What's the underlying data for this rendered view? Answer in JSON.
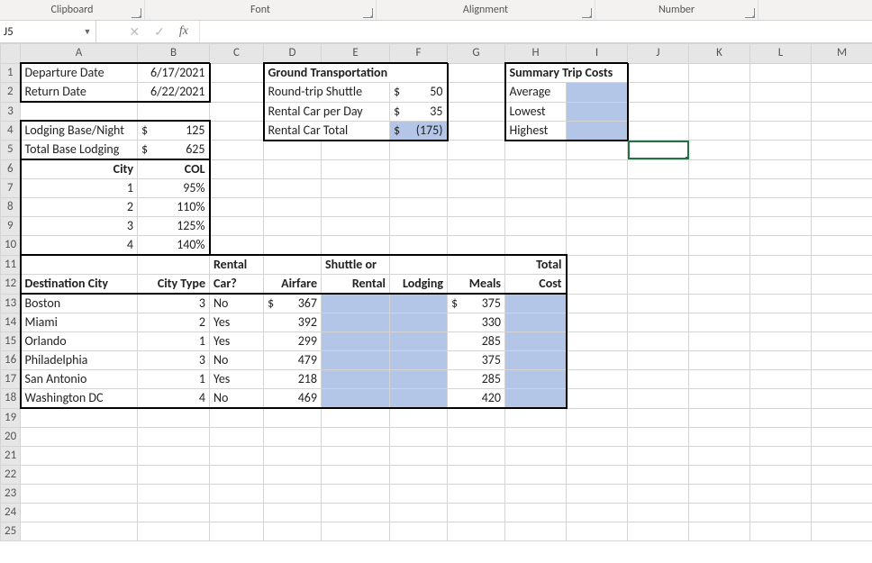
{
  "ribbon": {
    "groups": [
      "Clipboard",
      "Font",
      "Alignment",
      "Number"
    ]
  },
  "namebox": {
    "cell_ref": "J5"
  },
  "fx": {
    "label": "fx",
    "cancel": "✕",
    "enter": "✓",
    "value": ""
  },
  "col_headers": [
    "A",
    "B",
    "C",
    "D",
    "E",
    "F",
    "G",
    "H",
    "I",
    "J",
    "K",
    "L",
    "M"
  ],
  "row_headers": [
    "1",
    "2",
    "3",
    "4",
    "5",
    "6",
    "7",
    "8",
    "9",
    "10",
    "11",
    "12",
    "13",
    "14",
    "15",
    "16",
    "17",
    "18",
    "19",
    "20",
    "21",
    "22",
    "23",
    "24",
    "25"
  ],
  "cells": {
    "A1": "Departure Date",
    "B1": "6/17/2021",
    "A2": "Return Date",
    "B2": "6/22/2021",
    "A4": "Lodging Base/Night",
    "B4_sym": "$",
    "B4_val": "125",
    "A5": "Total Base Lodging",
    "B5_sym": "$",
    "B5_val": "625",
    "A6": "City",
    "B6": "COL",
    "A7": "1",
    "B7": "95%",
    "A8": "2",
    "B8": "110%",
    "A9": "3",
    "B9": "125%",
    "A10": "4",
    "B10": "140%",
    "D1": "Ground Transportation",
    "D2": "Round-trip Shuttle",
    "F2_sym": "$",
    "F2_val": "50",
    "D3": "Rental Car per Day",
    "F3_sym": "$",
    "F3_val": "35",
    "D4": "Rental Car Total",
    "F4_sym": "$",
    "F4_val": "(175)",
    "H1": "Summary Trip Costs",
    "H2": "Average",
    "H3": "Lowest",
    "H4": "Highest",
    "A12": "Destination City",
    "B12": "City Type",
    "C12a": "Rental",
    "C12b": "Car?",
    "D12": "Airfare",
    "E12a": "Shuttle or",
    "E12b": "Rental",
    "F12": "Lodging",
    "G12": "Meals",
    "H12a": "Total",
    "H12b": "Cost",
    "A13": "Boston",
    "B13": "3",
    "C13": "No",
    "D13_sym": "$",
    "D13_val": "367",
    "G13_sym": "$",
    "G13_val": "375",
    "A14": "Miami",
    "B14": "2",
    "C14": "Yes",
    "D14_val": "392",
    "G14_val": "330",
    "A15": "Orlando",
    "B15": "1",
    "C15": "Yes",
    "D15_val": "299",
    "G15_val": "285",
    "A16": "Philadelphia",
    "B16": "3",
    "C16": "No",
    "D16_val": "479",
    "G16_val": "375",
    "A17": "San Antonio",
    "B17": "1",
    "C17": "Yes",
    "D17_val": "218",
    "G17_val": "285",
    "A18": "Washington DC",
    "B18": "4",
    "C18": "No",
    "D18_val": "469",
    "G18_val": "420"
  },
  "chart_data": {
    "type": "table",
    "title": "Trip Cost Worksheet",
    "dates": {
      "departure": "6/17/2021",
      "return": "6/22/2021"
    },
    "lodging": {
      "base_per_night": 125,
      "total_base": 625
    },
    "col_table": {
      "City": [
        1,
        2,
        3,
        4
      ],
      "COL": [
        0.95,
        1.1,
        1.25,
        1.4
      ]
    },
    "ground_transportation": {
      "round_trip_shuttle": 50,
      "rental_car_per_day": 35,
      "rental_car_total": -175
    },
    "summary_trip_costs": {
      "average": null,
      "lowest": null,
      "highest": null
    },
    "destinations": [
      {
        "city": "Boston",
        "city_type": 3,
        "rental_car": "No",
        "airfare": 367,
        "shuttle_or_rental": null,
        "lodging": null,
        "meals": 375,
        "total_cost": null
      },
      {
        "city": "Miami",
        "city_type": 2,
        "rental_car": "Yes",
        "airfare": 392,
        "shuttle_or_rental": null,
        "lodging": null,
        "meals": 330,
        "total_cost": null
      },
      {
        "city": "Orlando",
        "city_type": 1,
        "rental_car": "Yes",
        "airfare": 299,
        "shuttle_or_rental": null,
        "lodging": null,
        "meals": 285,
        "total_cost": null
      },
      {
        "city": "Philadelphia",
        "city_type": 3,
        "rental_car": "No",
        "airfare": 479,
        "shuttle_or_rental": null,
        "lodging": null,
        "meals": 375,
        "total_cost": null
      },
      {
        "city": "San Antonio",
        "city_type": 1,
        "rental_car": "Yes",
        "airfare": 218,
        "shuttle_or_rental": null,
        "lodging": null,
        "meals": 285,
        "total_cost": null
      },
      {
        "city": "Washington DC",
        "city_type": 4,
        "rental_car": "No",
        "airfare": 469,
        "shuttle_or_rental": null,
        "lodging": null,
        "meals": 420,
        "total_cost": null
      }
    ]
  }
}
